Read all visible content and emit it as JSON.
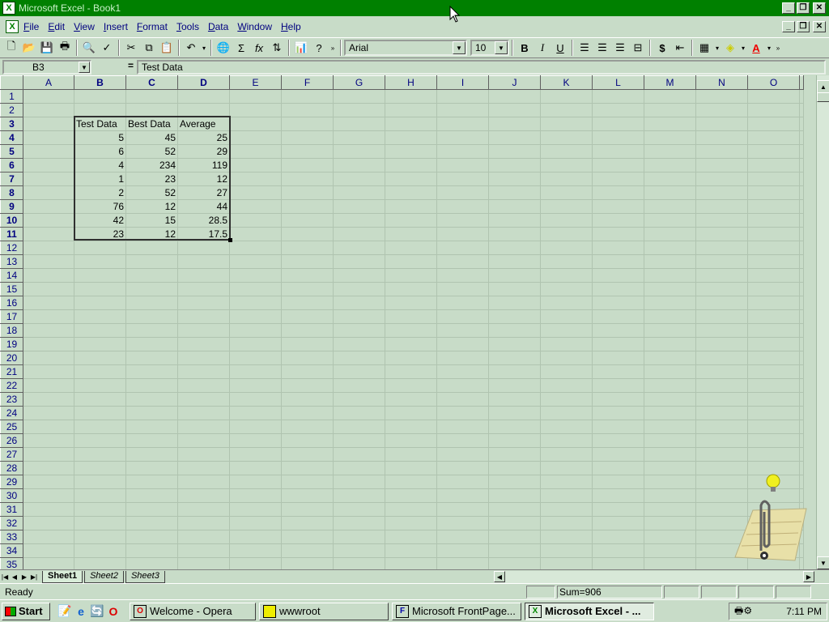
{
  "window": {
    "title": "Microsoft Excel - Book1",
    "minimize": "_",
    "restore": "❐",
    "close": "✕"
  },
  "menu": [
    "File",
    "Edit",
    "View",
    "Insert",
    "Format",
    "Tools",
    "Data",
    "Window",
    "Help"
  ],
  "toolbar": {
    "font": "Arial",
    "font_size": "10",
    "bold": "B",
    "italic": "I",
    "underline": "U",
    "currency": "$"
  },
  "formula_bar": {
    "name_box": "B3",
    "equals": "=",
    "value": "Test Data"
  },
  "columns": [
    "A",
    "B",
    "C",
    "D",
    "E",
    "F",
    "G",
    "H",
    "I",
    "J",
    "K",
    "L",
    "M",
    "N",
    "O"
  ],
  "rows": [
    "1",
    "2",
    "3",
    "4",
    "5",
    "6",
    "7",
    "8",
    "9",
    "10",
    "11",
    "12",
    "13",
    "14",
    "15",
    "16",
    "17",
    "18",
    "19",
    "20",
    "21",
    "22",
    "23",
    "24",
    "25",
    "26",
    "27",
    "28",
    "29",
    "30",
    "31",
    "32",
    "33",
    "34",
    "35"
  ],
  "data": {
    "headers": [
      "Test Data",
      "Best Data",
      "Average"
    ],
    "rows": [
      [
        "5",
        "45",
        "25"
      ],
      [
        "6",
        "52",
        "29"
      ],
      [
        "4",
        "234",
        "119"
      ],
      [
        "1",
        "23",
        "12"
      ],
      [
        "2",
        "52",
        "27"
      ],
      [
        "76",
        "12",
        "44"
      ],
      [
        "42",
        "15",
        "28.5"
      ],
      [
        "23",
        "12",
        "17.5"
      ]
    ]
  },
  "sheets": [
    "Sheet1",
    "Sheet2",
    "Sheet3"
  ],
  "status": {
    "ready": "Ready",
    "sum": "Sum=906"
  },
  "taskbar": {
    "start": "Start",
    "tasks": [
      "Welcome - Opera",
      "wwwroot",
      "Microsoft FrontPage...",
      "Microsoft Excel - ..."
    ],
    "clock": "7:11 PM"
  },
  "colors": {
    "title_bar": "#008000",
    "background": "#c8dcc8"
  }
}
